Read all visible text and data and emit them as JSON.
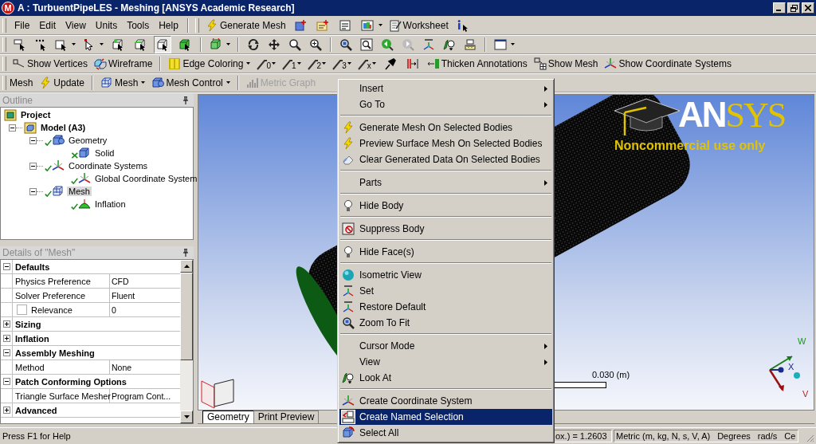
{
  "window": {
    "app_letter": "M",
    "title": "A : TurbuentPipeLES - Meshing [ANSYS Academic Research]"
  },
  "menu": [
    "File",
    "Edit",
    "View",
    "Units",
    "Tools",
    "Help"
  ],
  "main_toolbar": {
    "generate": "Generate Mesh",
    "worksheet": "Worksheet"
  },
  "selection_filters": [
    {
      "selected": false
    },
    {
      "selected": false
    },
    {
      "selected": true
    },
    {
      "selected": false
    }
  ],
  "display_toolbar": {
    "left": [
      {
        "label": "Show Vertices",
        "kind": "button"
      },
      {
        "label": "Wireframe",
        "kind": "button"
      },
      {
        "label": "Edge Coloring",
        "kind": "dropdown"
      }
    ],
    "edge_widths": [
      "0",
      "1",
      "2",
      "3",
      "x"
    ],
    "right": [
      {
        "label": "Thicken Annotations"
      },
      {
        "label": "Show Mesh"
      },
      {
        "label": "Show Coordinate Systems"
      }
    ]
  },
  "mesh_toolbar": {
    "title": "Mesh",
    "buttons": [
      {
        "label": "Update",
        "kind": "button",
        "disabled": false
      },
      {
        "label": "Mesh",
        "kind": "dropdown",
        "disabled": false
      },
      {
        "label": "Mesh Control",
        "kind": "dropdown",
        "disabled": false
      },
      {
        "label": "Metric Graph",
        "kind": "button",
        "disabled": true
      }
    ]
  },
  "outline": {
    "title": "Outline",
    "tree": [
      {
        "label": "Project",
        "kind": "project",
        "selected": false,
        "children": [
          {
            "label": "Model (A3)",
            "kind": "model",
            "selected": false,
            "expanded": true,
            "children": [
              {
                "label": "Geometry",
                "kind": "geometry",
                "complete": true,
                "selected": false,
                "expanded": true,
                "children": [
                  {
                    "label": "Solid",
                    "kind": "body",
                    "complete": false,
                    "selected": false
                  }
                ]
              },
              {
                "label": "Coordinate Systems",
                "kind": "coordinate_systems",
                "complete": true,
                "selected": false,
                "expanded": true,
                "children": [
                  {
                    "label": "Global Coordinate System",
                    "kind": "coordinate_system",
                    "complete": true,
                    "selected": false
                  }
                ]
              },
              {
                "label": "Mesh",
                "kind": "mesh",
                "complete": true,
                "selected": true,
                "expanded": true,
                "children": [
                  {
                    "label": "Inflation",
                    "kind": "inflation",
                    "complete": true,
                    "selected": false
                  }
                ]
              }
            ]
          }
        ]
      }
    ]
  },
  "details": {
    "title": "Details of \"Mesh\"",
    "rows": [
      {
        "kind": "section",
        "label": "Defaults",
        "expanded": true
      },
      {
        "kind": "property",
        "label": "Physics Preference",
        "value": "CFD"
      },
      {
        "kind": "property",
        "label": "Solver Preference",
        "value": "Fluent"
      },
      {
        "kind": "check_property",
        "label": "Relevance",
        "value": "0",
        "checked": false
      },
      {
        "kind": "section",
        "label": "Sizing",
        "expanded": false
      },
      {
        "kind": "section",
        "label": "Inflation",
        "expanded": false
      },
      {
        "kind": "section",
        "label": "Assembly Meshing",
        "expanded": true
      },
      {
        "kind": "property",
        "label": "Method",
        "value": "None"
      },
      {
        "kind": "section",
        "label": "Patch Conforming Options",
        "expanded": true
      },
      {
        "kind": "property",
        "label": "Triangle Surface Mesher",
        "value": "Program Cont..."
      },
      {
        "kind": "section",
        "label": "Advanced",
        "expanded": false
      }
    ]
  },
  "viewport": {
    "logo": [
      "AN",
      "SYS"
    ],
    "logo_note": "Noncommercial use only",
    "scale": "0.030 (m)",
    "triad": [
      "W",
      "X",
      "V"
    ],
    "tabs": [
      {
        "label": "Geometry",
        "selected": true
      },
      {
        "label": "Print Preview",
        "selected": false
      }
    ]
  },
  "context_menu": [
    {
      "kind": "item",
      "label": "Insert",
      "submenu": true,
      "selected": false
    },
    {
      "kind": "item",
      "label": "Go To",
      "submenu": true,
      "selected": false
    },
    {
      "kind": "separator"
    },
    {
      "kind": "item",
      "label": "Generate Mesh On Selected Bodies",
      "submenu": false,
      "selected": false
    },
    {
      "kind": "item",
      "label": "Preview Surface Mesh On Selected Bodies",
      "submenu": false,
      "selected": false
    },
    {
      "kind": "item",
      "label": "Clear Generated Data On Selected Bodies",
      "submenu": false,
      "selected": false
    },
    {
      "kind": "separator"
    },
    {
      "kind": "item",
      "label": "Parts",
      "submenu": true,
      "selected": false
    },
    {
      "kind": "separator"
    },
    {
      "kind": "item",
      "label": "Hide Body",
      "submenu": false,
      "selected": false
    },
    {
      "kind": "separator"
    },
    {
      "kind": "item",
      "label": "Suppress Body",
      "submenu": false,
      "selected": false
    },
    {
      "kind": "separator"
    },
    {
      "kind": "item",
      "label": "Hide Face(s)",
      "submenu": false,
      "selected": false
    },
    {
      "kind": "separator"
    },
    {
      "kind": "item",
      "label": "Isometric View",
      "submenu": false,
      "selected": false
    },
    {
      "kind": "item",
      "label": "Set",
      "submenu": false,
      "selected": false
    },
    {
      "kind": "item",
      "label": "Restore Default",
      "submenu": false,
      "selected": false
    },
    {
      "kind": "item",
      "label": "Zoom To Fit",
      "submenu": false,
      "selected": false
    },
    {
      "kind": "separator"
    },
    {
      "kind": "item",
      "label": "Cursor Mode",
      "submenu": true,
      "selected": false
    },
    {
      "kind": "item",
      "label": "View",
      "submenu": true,
      "selected": false
    },
    {
      "kind": "item",
      "label": "Look At",
      "submenu": false,
      "selected": false
    },
    {
      "kind": "separator"
    },
    {
      "kind": "item",
      "label": "Create Coordinate System",
      "submenu": false,
      "selected": false
    },
    {
      "kind": "item",
      "label": "Create Named Selection",
      "submenu": false,
      "selected": true
    },
    {
      "kind": "item",
      "label": "Select All",
      "submenu": false,
      "selected": false
    }
  ],
  "status_bar": {
    "help": "Press F1 for Help",
    "value": "ox.) = 1.2603",
    "units": [
      "Metric (m, kg, N, s, V, A)",
      "Degrees",
      "rad/s",
      "Ce"
    ]
  }
}
